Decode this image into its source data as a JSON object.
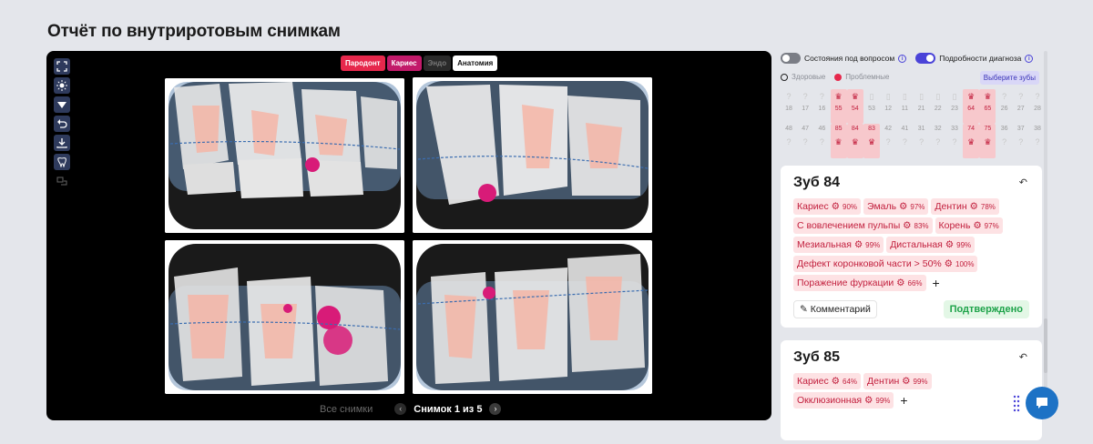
{
  "page": {
    "title": "Отчёт по внутриротовым снимкам"
  },
  "viewer": {
    "tools": [
      "expand-icon",
      "brightness-icon",
      "triangle-filter-icon",
      "undo-icon",
      "download-icon",
      "tooth-search-icon",
      "swap-icon"
    ],
    "filters": [
      {
        "label": "Пародонт",
        "style": "perio"
      },
      {
        "label": "Кариес",
        "style": "caries"
      },
      {
        "label": "Эндо",
        "style": "endo"
      },
      {
        "label": "Анатомия",
        "style": "anat"
      }
    ],
    "pager": {
      "all_label": "Все снимки",
      "current_label": "Снимок 1 из 5",
      "prev_icon": "chevron-left-icon",
      "next_icon": "chevron-right-icon"
    }
  },
  "sidebar": {
    "toggle_questionable": "Состояния под вопросом",
    "toggle_details": "Подробности диагноза",
    "legend_healthy": "Здоровые",
    "legend_problem": "Проблемные",
    "select_teeth": "Выберите зубы",
    "upper_row": [
      "18",
      "17",
      "16",
      "55",
      "54",
      "53",
      "12",
      "11",
      "21",
      "22",
      "23",
      "64",
      "65",
      "26",
      "27",
      "28"
    ],
    "lower_row": [
      "48",
      "47",
      "46",
      "85",
      "84",
      "83",
      "42",
      "41",
      "31",
      "32",
      "33",
      "74",
      "75",
      "36",
      "37",
      "38"
    ],
    "problem_teeth": [
      "55",
      "54",
      "64",
      "65",
      "85",
      "84",
      "83",
      "74",
      "75"
    ]
  },
  "cards": [
    {
      "title": "Зуб 84",
      "tags": [
        {
          "label": "Кариес",
          "pct": "90%"
        },
        {
          "label": "Эмаль",
          "pct": "97%"
        },
        {
          "label": "Дентин",
          "pct": "78%"
        },
        {
          "label": "С вовлечением пульпы",
          "pct": "83%"
        },
        {
          "label": "Корень",
          "pct": "97%"
        },
        {
          "label": "Мезиальная",
          "pct": "99%"
        },
        {
          "label": "Дистальная",
          "pct": "99%"
        },
        {
          "label": "Дефект коронковой части > 50%",
          "pct": "100%"
        },
        {
          "label": "Поражение фуркации",
          "pct": "66%"
        }
      ],
      "comment_label": "Комментарий",
      "status_label": "Подтверждено"
    },
    {
      "title": "Зуб 85",
      "tags": [
        {
          "label": "Кариес",
          "pct": "64%"
        },
        {
          "label": "Дентин",
          "pct": "99%"
        },
        {
          "label": "Окклюзионная",
          "pct": "99%"
        }
      ]
    }
  ],
  "colors": {
    "accent": "#4a43d8",
    "problem": "#e6284c",
    "confirmed": "#1ea34a",
    "chat": "#1d72c5"
  }
}
